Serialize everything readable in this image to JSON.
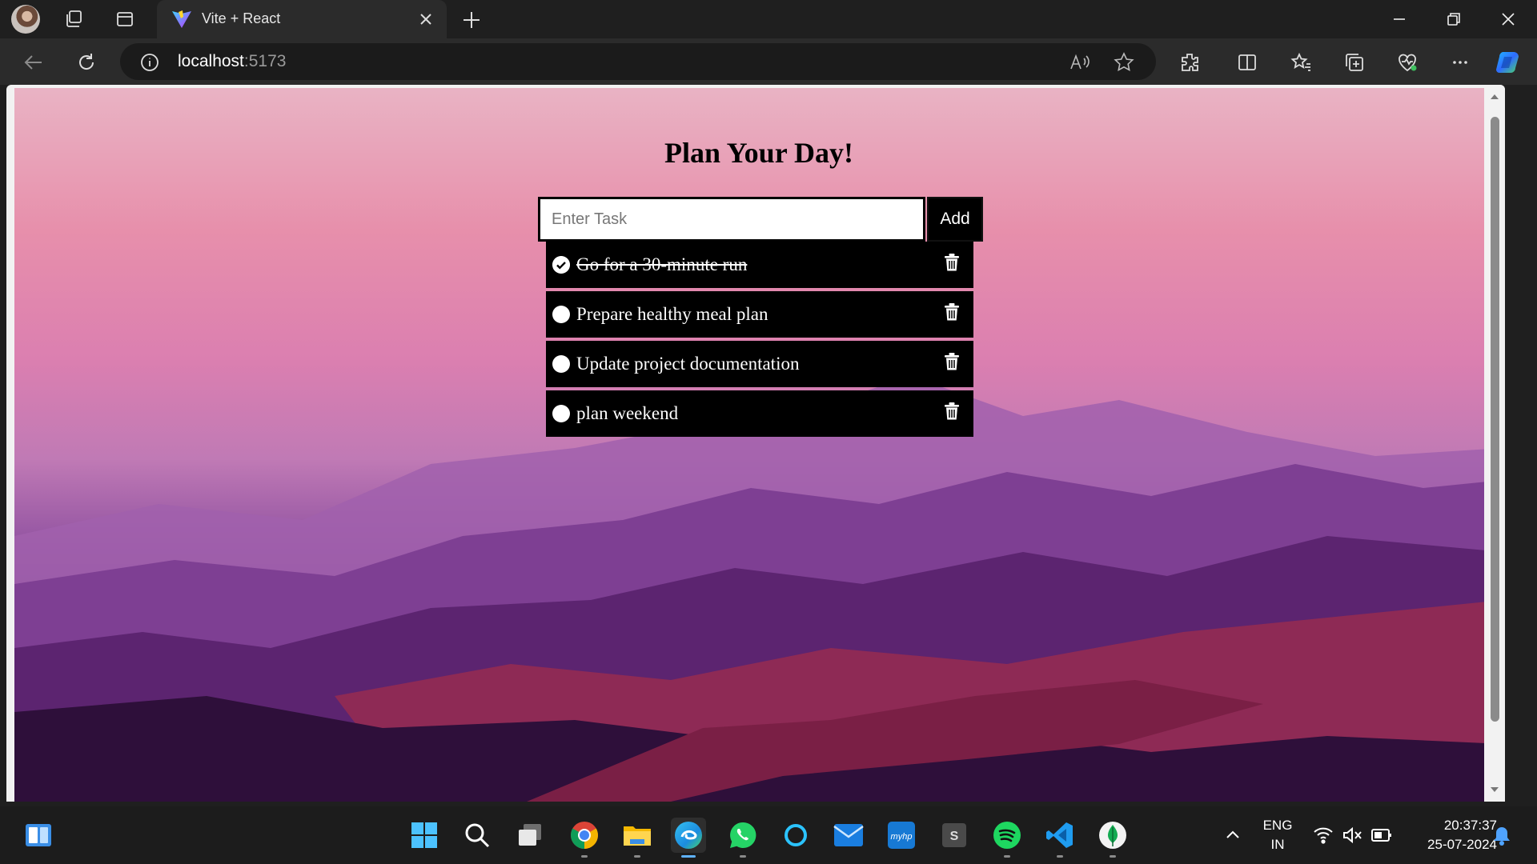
{
  "browser": {
    "tab_title": "Vite + React",
    "url_host": "localhost",
    "url_port": ":5173",
    "accent": "#1a73e8"
  },
  "app": {
    "heading": "Plan Your Day!",
    "input_placeholder": "Enter Task",
    "add_label": "Add",
    "tasks": [
      {
        "text": "Go for a 30-minute run",
        "done": true
      },
      {
        "text": "Prepare healthy meal plan",
        "done": false
      },
      {
        "text": "Update project documentation",
        "done": false
      },
      {
        "text": "plan weekend",
        "done": false
      }
    ]
  },
  "taskbar": {
    "language": "ENG",
    "region": "IN",
    "time": "20:37:37",
    "date": "25-07-2024"
  }
}
